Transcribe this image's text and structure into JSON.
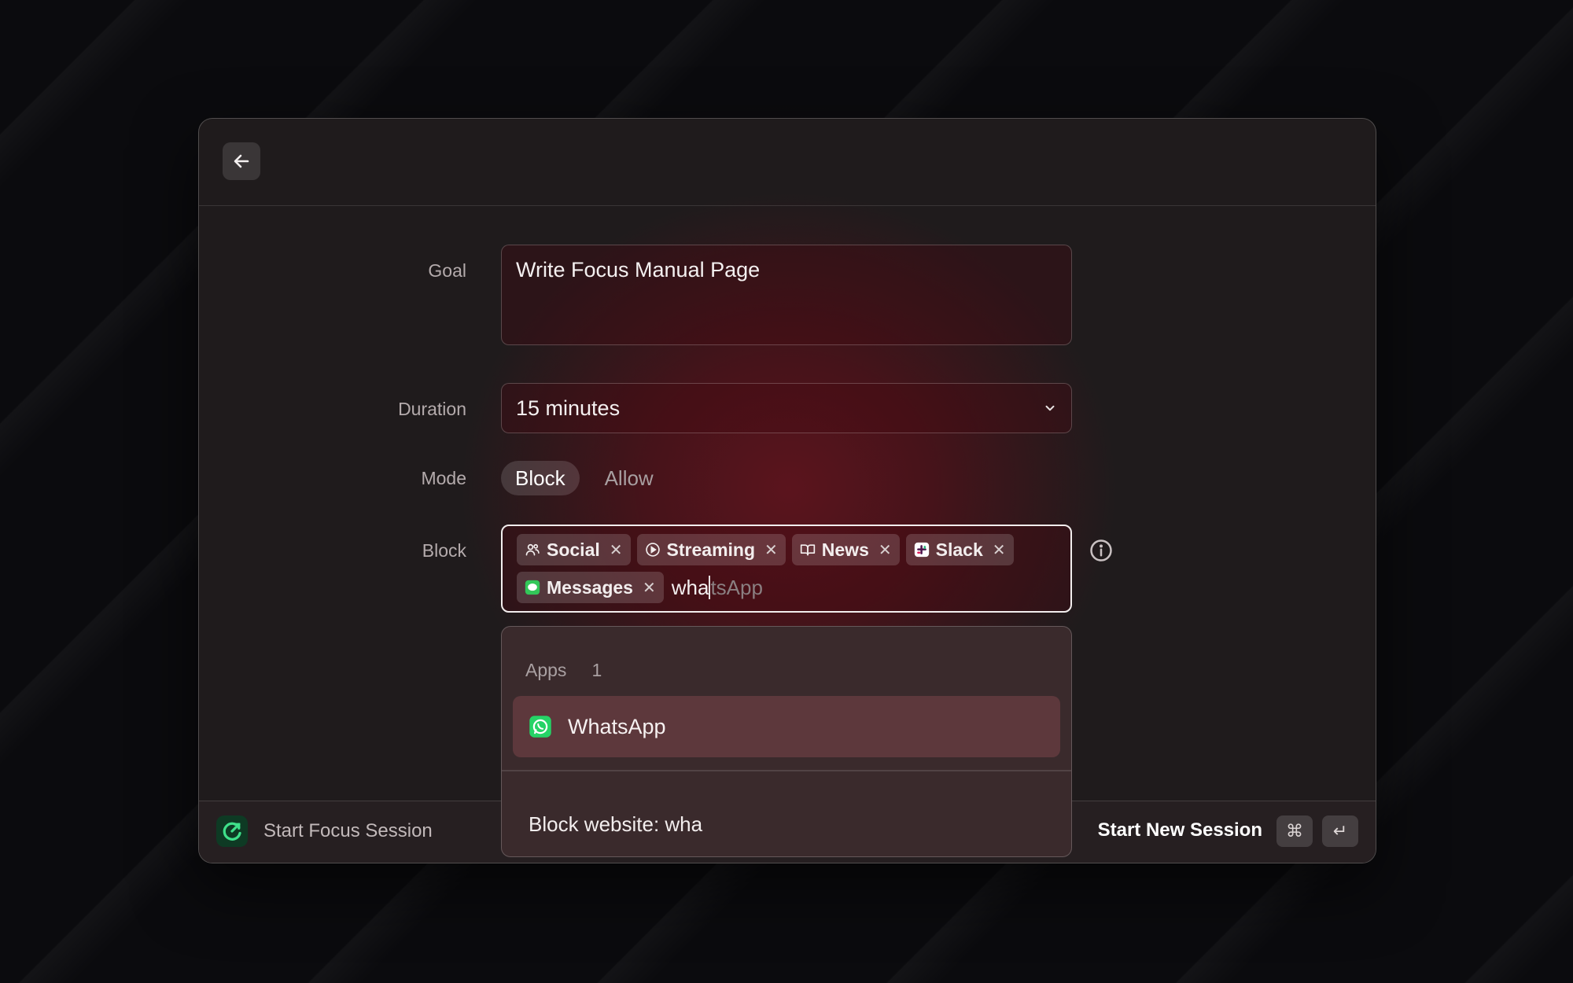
{
  "window": {
    "back_icon": "arrow-left-icon"
  },
  "form": {
    "goal_label": "Goal",
    "goal_value": "Write Focus Manual Page",
    "duration_label": "Duration",
    "duration_value": "15 minutes",
    "mode_label": "Mode",
    "mode_options": [
      "Block",
      "Allow"
    ],
    "mode_selected": "Block",
    "block_label": "Block",
    "chips": [
      {
        "label": "Social",
        "icon": "people-icon"
      },
      {
        "label": "Streaming",
        "icon": "play-circle-icon"
      },
      {
        "label": "News",
        "icon": "book-open-icon"
      },
      {
        "label": "Slack",
        "icon": "slack-icon"
      },
      {
        "label": "Messages",
        "icon": "messages-icon"
      }
    ],
    "input_typed": "wha",
    "input_suggestion": "tsApp"
  },
  "dropdown": {
    "section_title": "Apps",
    "section_count": "1",
    "items": [
      {
        "label": "WhatsApp",
        "icon": "whatsapp-icon"
      }
    ],
    "action_label": "Block website: wha"
  },
  "footer": {
    "title": "Start Focus Session",
    "primary_action": "Start New Session",
    "shortcut_keys": [
      "⌘",
      "↵"
    ]
  },
  "colors": {
    "accent_red": "#5b141d",
    "highlight": "#5d383c",
    "whatsapp_green": "#25d366"
  }
}
